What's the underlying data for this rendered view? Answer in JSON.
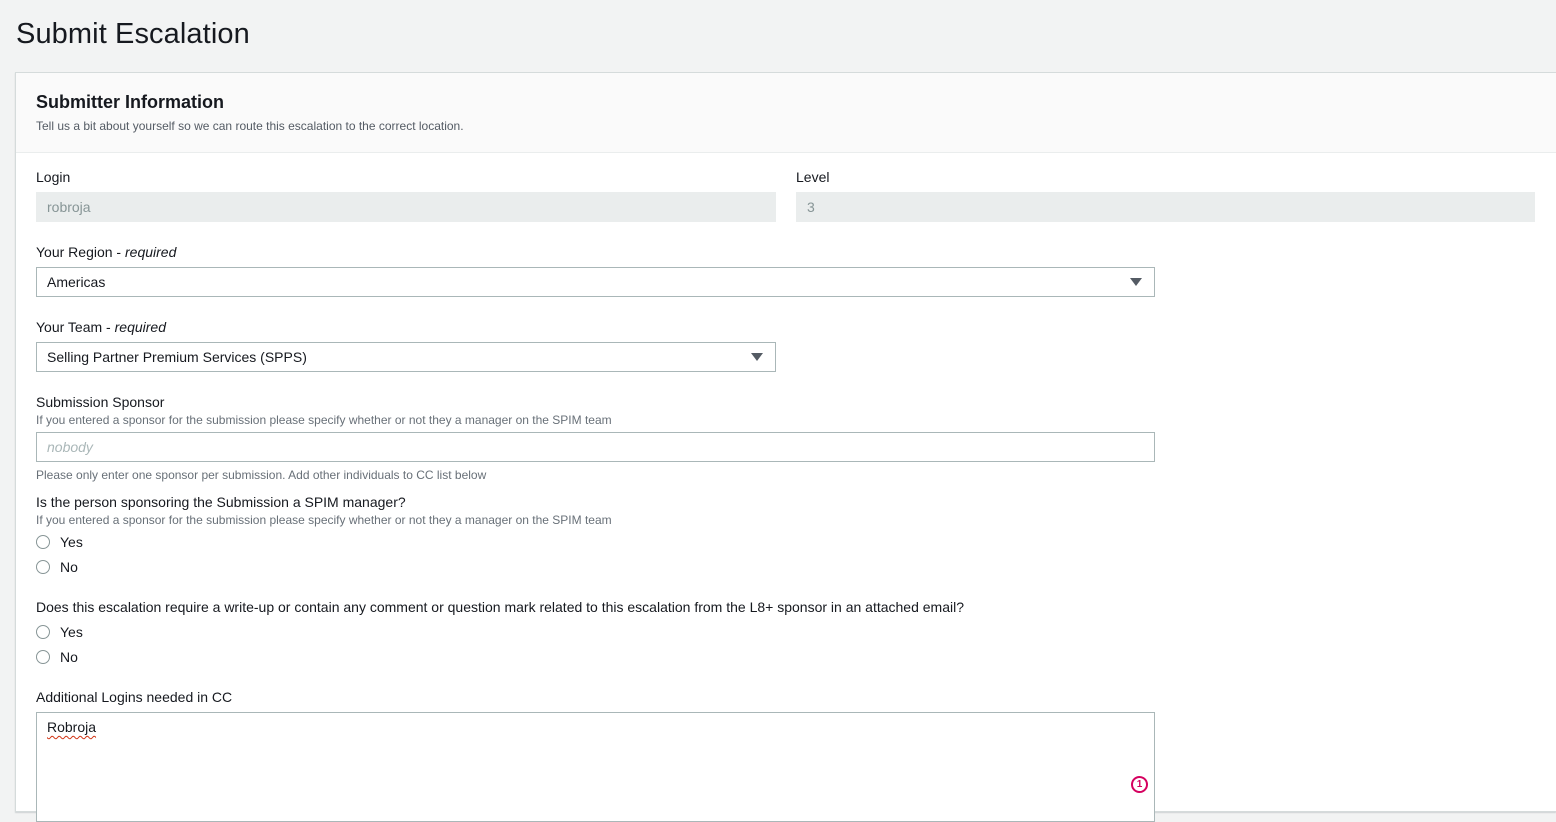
{
  "page": {
    "title": "Submit Escalation"
  },
  "section": {
    "title": "Submitter Information",
    "description": "Tell us a bit about yourself so we can route this escalation to the correct location."
  },
  "login": {
    "label": "Login",
    "value": "robroja"
  },
  "level": {
    "label": "Level",
    "value": "3"
  },
  "region": {
    "label": "Your Region",
    "required": "required",
    "value": "Americas"
  },
  "team": {
    "label": "Your Team",
    "required": "required",
    "value": "Selling Partner Premium Services (SPPS)"
  },
  "sponsor": {
    "label": "Submission Sponsor",
    "hint": "If you entered a sponsor for the submission please specify whether or not they a manager on the SPIM team",
    "placeholder": "nobody",
    "footer": "Please only enter one sponsor per submission. Add other individuals to CC list below"
  },
  "spim_manager": {
    "question": "Is the person sponsoring the Submission a SPIM manager?",
    "hint": "If you entered a sponsor for the submission please specify whether or not they a manager on the SPIM team",
    "options": [
      "Yes",
      "No"
    ]
  },
  "writeup": {
    "question": "Does this escalation require a write-up or contain any comment or question mark related to this escalation from the L8+ sponsor in an attached email?",
    "options": [
      "Yes",
      "No"
    ]
  },
  "cc": {
    "label": "Additional Logins needed in CC",
    "value": "Robroja",
    "badge": "1"
  }
}
